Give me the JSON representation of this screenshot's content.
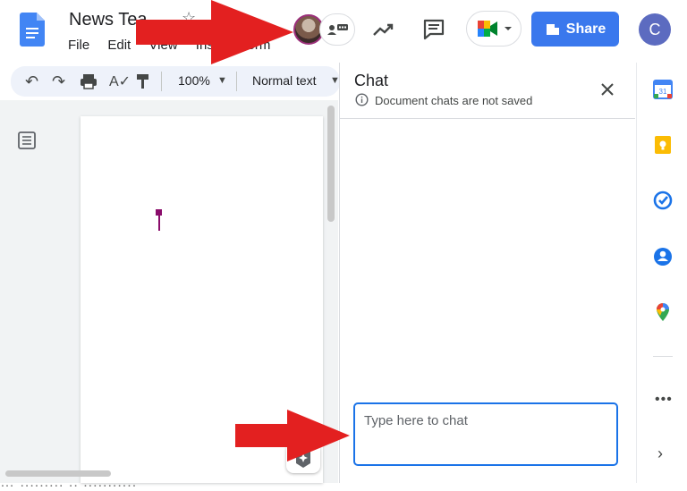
{
  "header": {
    "doc_title": "News Tea",
    "menu": [
      "File",
      "Edit",
      "View",
      "Inse",
      "Form"
    ],
    "share_label": "Share",
    "account_initial": "C"
  },
  "toolbar": {
    "zoom": "100%",
    "style": "Normal text"
  },
  "chat": {
    "title": "Chat",
    "note": "Document chats are not saved",
    "input_placeholder": "Type here to chat"
  },
  "side_panel": {
    "calendar_day": "31",
    "icons": [
      "calendar-icon",
      "keep-icon",
      "tasks-icon",
      "contacts-icon",
      "maps-icon",
      "more-icon",
      "expand-icon"
    ]
  },
  "document": {
    "bottom_text": "… ......... .. ..........."
  },
  "colors": {
    "share_blue": "#3a78ed",
    "focus_blue": "#1a73e8",
    "annotation_red": "#e32020",
    "cursor_purple": "#8a0d6b",
    "account_avatar": "#5c6bc0"
  }
}
